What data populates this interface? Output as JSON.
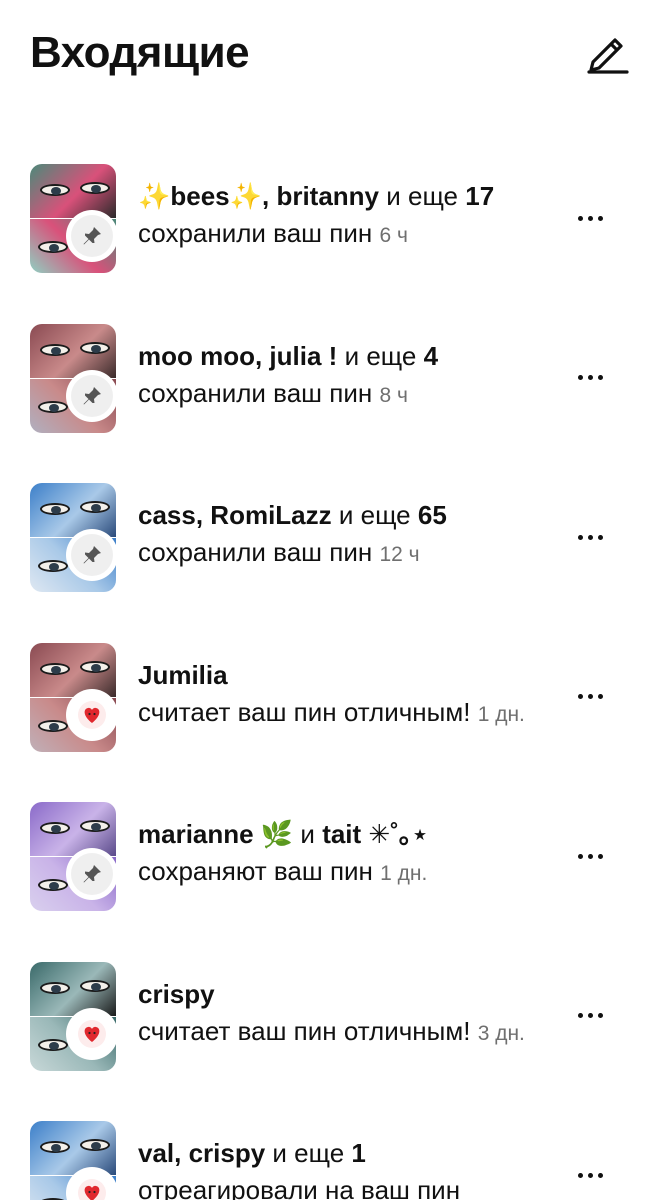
{
  "header": {
    "title": "Входящие"
  },
  "notifications": [
    {
      "names": "✨bees✨, britanny",
      "joiner": " и еще ",
      "count": "17",
      "action": "сохранили ваш пин",
      "time": "6 ч",
      "badge": "pin-icon",
      "palette": [
        "#4b8a7a",
        "#d9517a",
        "#2a2a2a",
        "#8fd0c2"
      ]
    },
    {
      "names": "moo moo, julia !",
      "joiner": " и еще ",
      "count": "4",
      "action": "сохранили ваш пин",
      "time": "8 ч",
      "badge": "pin-icon",
      "palette": [
        "#8a4a52",
        "#c98a8a",
        "#3a2a2a",
        "#b0b0c0"
      ]
    },
    {
      "names": "cass, RomiLazz",
      "joiner": " и еще ",
      "count": "65",
      "action": "сохранили ваш пин",
      "time": "12 ч",
      "badge": "pin-icon",
      "palette": [
        "#3c7fc9",
        "#a9c9e8",
        "#2a4a7a",
        "#dfe8f2"
      ]
    },
    {
      "names": "Jumilia",
      "joiner": "",
      "count": "",
      "action": "считает ваш пин отличным!",
      "time": "1 дн.",
      "badge": "heart-icon",
      "palette": [
        "#8a4a52",
        "#c98a8a",
        "#3a2a2a",
        "#c0b0b8"
      ]
    },
    {
      "names": "marianne 🌿",
      "joiner": " и ",
      "count": "tait ✳︎˚｡⋆",
      "action": "сохраняют ваш пин",
      "time": "1 дн.",
      "badge": "pin-icon",
      "palette": [
        "#8a6ac9",
        "#c9b3e8",
        "#5a4a8a",
        "#d9d0ee"
      ]
    },
    {
      "names": "crispy",
      "joiner": "",
      "count": "",
      "action": "считает ваш пин отличным!",
      "time": "3 дн.",
      "badge": "heart-icon",
      "palette": [
        "#3a6a6a",
        "#9ab8b8",
        "#1a1a1a",
        "#c8d8d8"
      ]
    },
    {
      "names": "val, crispy",
      "joiner": " и еще ",
      "count": "1",
      "action": "отреагировали на ваш пин",
      "time": "",
      "badge": "heart-icon",
      "palette": [
        "#3c7fc9",
        "#a9c9e8",
        "#2a4a7a",
        "#dfe8f2"
      ]
    }
  ],
  "colors": {
    "heart": "#e0282e",
    "pin_bg": "#efefef",
    "pin_glyph": "#555555",
    "text": "#111111",
    "time": "#6f6f6f"
  }
}
